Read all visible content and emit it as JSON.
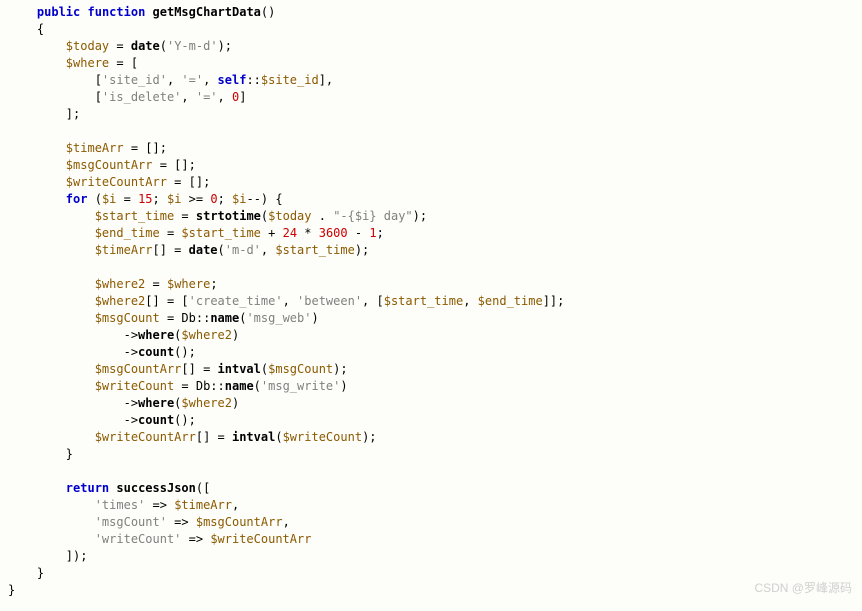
{
  "code": {
    "l1_kw1": "public",
    "l1_kw2": "function",
    "l1_fn": "getMsgChartData",
    "l2_brace": "{",
    "l3_var": "$today",
    "l3_fn": "date",
    "l3_str": "'Y-m-d'",
    "l4_var": "$where",
    "l5_str1": "'site_id'",
    "l5_str2": "'='",
    "l5_kw": "self",
    "l5_var": "$site_id",
    "l6_str1": "'is_delete'",
    "l6_str2": "'='",
    "l6_num": "0",
    "l8_var": "$timeArr",
    "l9_var": "$msgCountArr",
    "l10_var": "$writeCountArr",
    "l11_kw": "for",
    "l11_var1": "$i",
    "l11_num1": "15",
    "l11_var2": "$i",
    "l11_num2": "0",
    "l11_var3": "$i",
    "l12_var1": "$start_time",
    "l12_fn": "strtotime",
    "l12_var2": "$today",
    "l12_str": "\"-{$i} day\"",
    "l13_var1": "$end_time",
    "l13_var2": "$start_time",
    "l13_num1": "24",
    "l13_num2": "3600",
    "l13_num3": "1",
    "l14_var1": "$timeArr",
    "l14_fn": "date",
    "l14_str": "'m-d'",
    "l14_var2": "$start_time",
    "l16_var1": "$where2",
    "l16_var2": "$where",
    "l17_var1": "$where2",
    "l17_str1": "'create_time'",
    "l17_str2": "'between'",
    "l17_var2": "$start_time",
    "l17_var3": "$end_time",
    "l18_var": "$msgCount",
    "l18_fn": "name",
    "l18_str": "'msg_web'",
    "l19_fn": "where",
    "l19_var": "$where2",
    "l20_fn": "count",
    "l21_var1": "$msgCountArr",
    "l21_fn": "intval",
    "l21_var2": "$msgCount",
    "l22_var": "$writeCount",
    "l22_fn": "name",
    "l22_str": "'msg_write'",
    "l23_fn": "where",
    "l23_var": "$where2",
    "l24_fn": "count",
    "l25_var1": "$writeCountArr",
    "l25_fn": "intval",
    "l25_var2": "$writeCount",
    "l28_kw": "return",
    "l28_fn": "successJson",
    "l29_str": "'times'",
    "l29_var": "$timeArr",
    "l30_str": "'msgCount'",
    "l30_var": "$msgCountArr",
    "l31_str": "'writeCount'",
    "l31_var": "$writeCountArr"
  },
  "watermark": "CSDN @罗峰源码"
}
